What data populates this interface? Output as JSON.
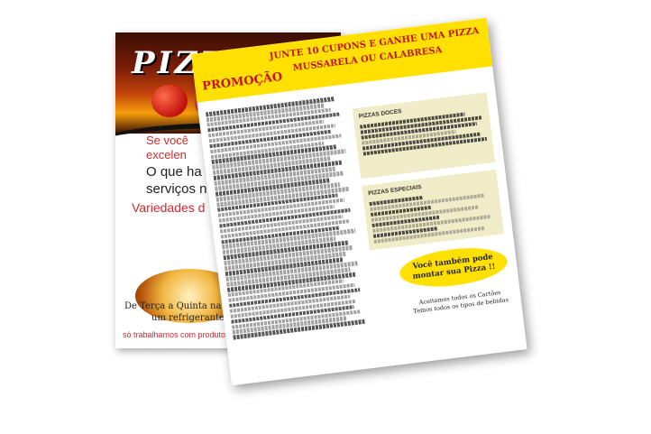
{
  "back_flyer": {
    "brand": "PIZZARIA",
    "slogan_1": "Se você",
    "slogan_2": "excelen",
    "question_1": "O que ha",
    "question_2": "serviços n",
    "variety": "Variedades d",
    "offer_1": "De Terça a Quinta na comp",
    "offer_2": "um refrigerante Guara",
    "footer": "só trabalhamos com produtos o"
  },
  "front_flyer": {
    "promo_label": "PROMOÇÃO",
    "promo_line_1": "JUNTE 10 CUPONS E GANHE UMA PIZZA",
    "promo_line_2": "MUSSARELA OU CALABRESA",
    "sweet_title": "PIZZAS DOCES",
    "special_title": "PIZZAS ESPECIAIS",
    "bubble_1": "Você também pode",
    "bubble_2": "montar sua Pizza !!",
    "accept_1": "Aceitamos todos os Cartões",
    "accept_2": "Temos todos os tipos de bebidas"
  },
  "colors": {
    "promo_yellow": "#ffe000",
    "promo_red": "#c0171c",
    "box_beige": "#f1ecc8"
  }
}
